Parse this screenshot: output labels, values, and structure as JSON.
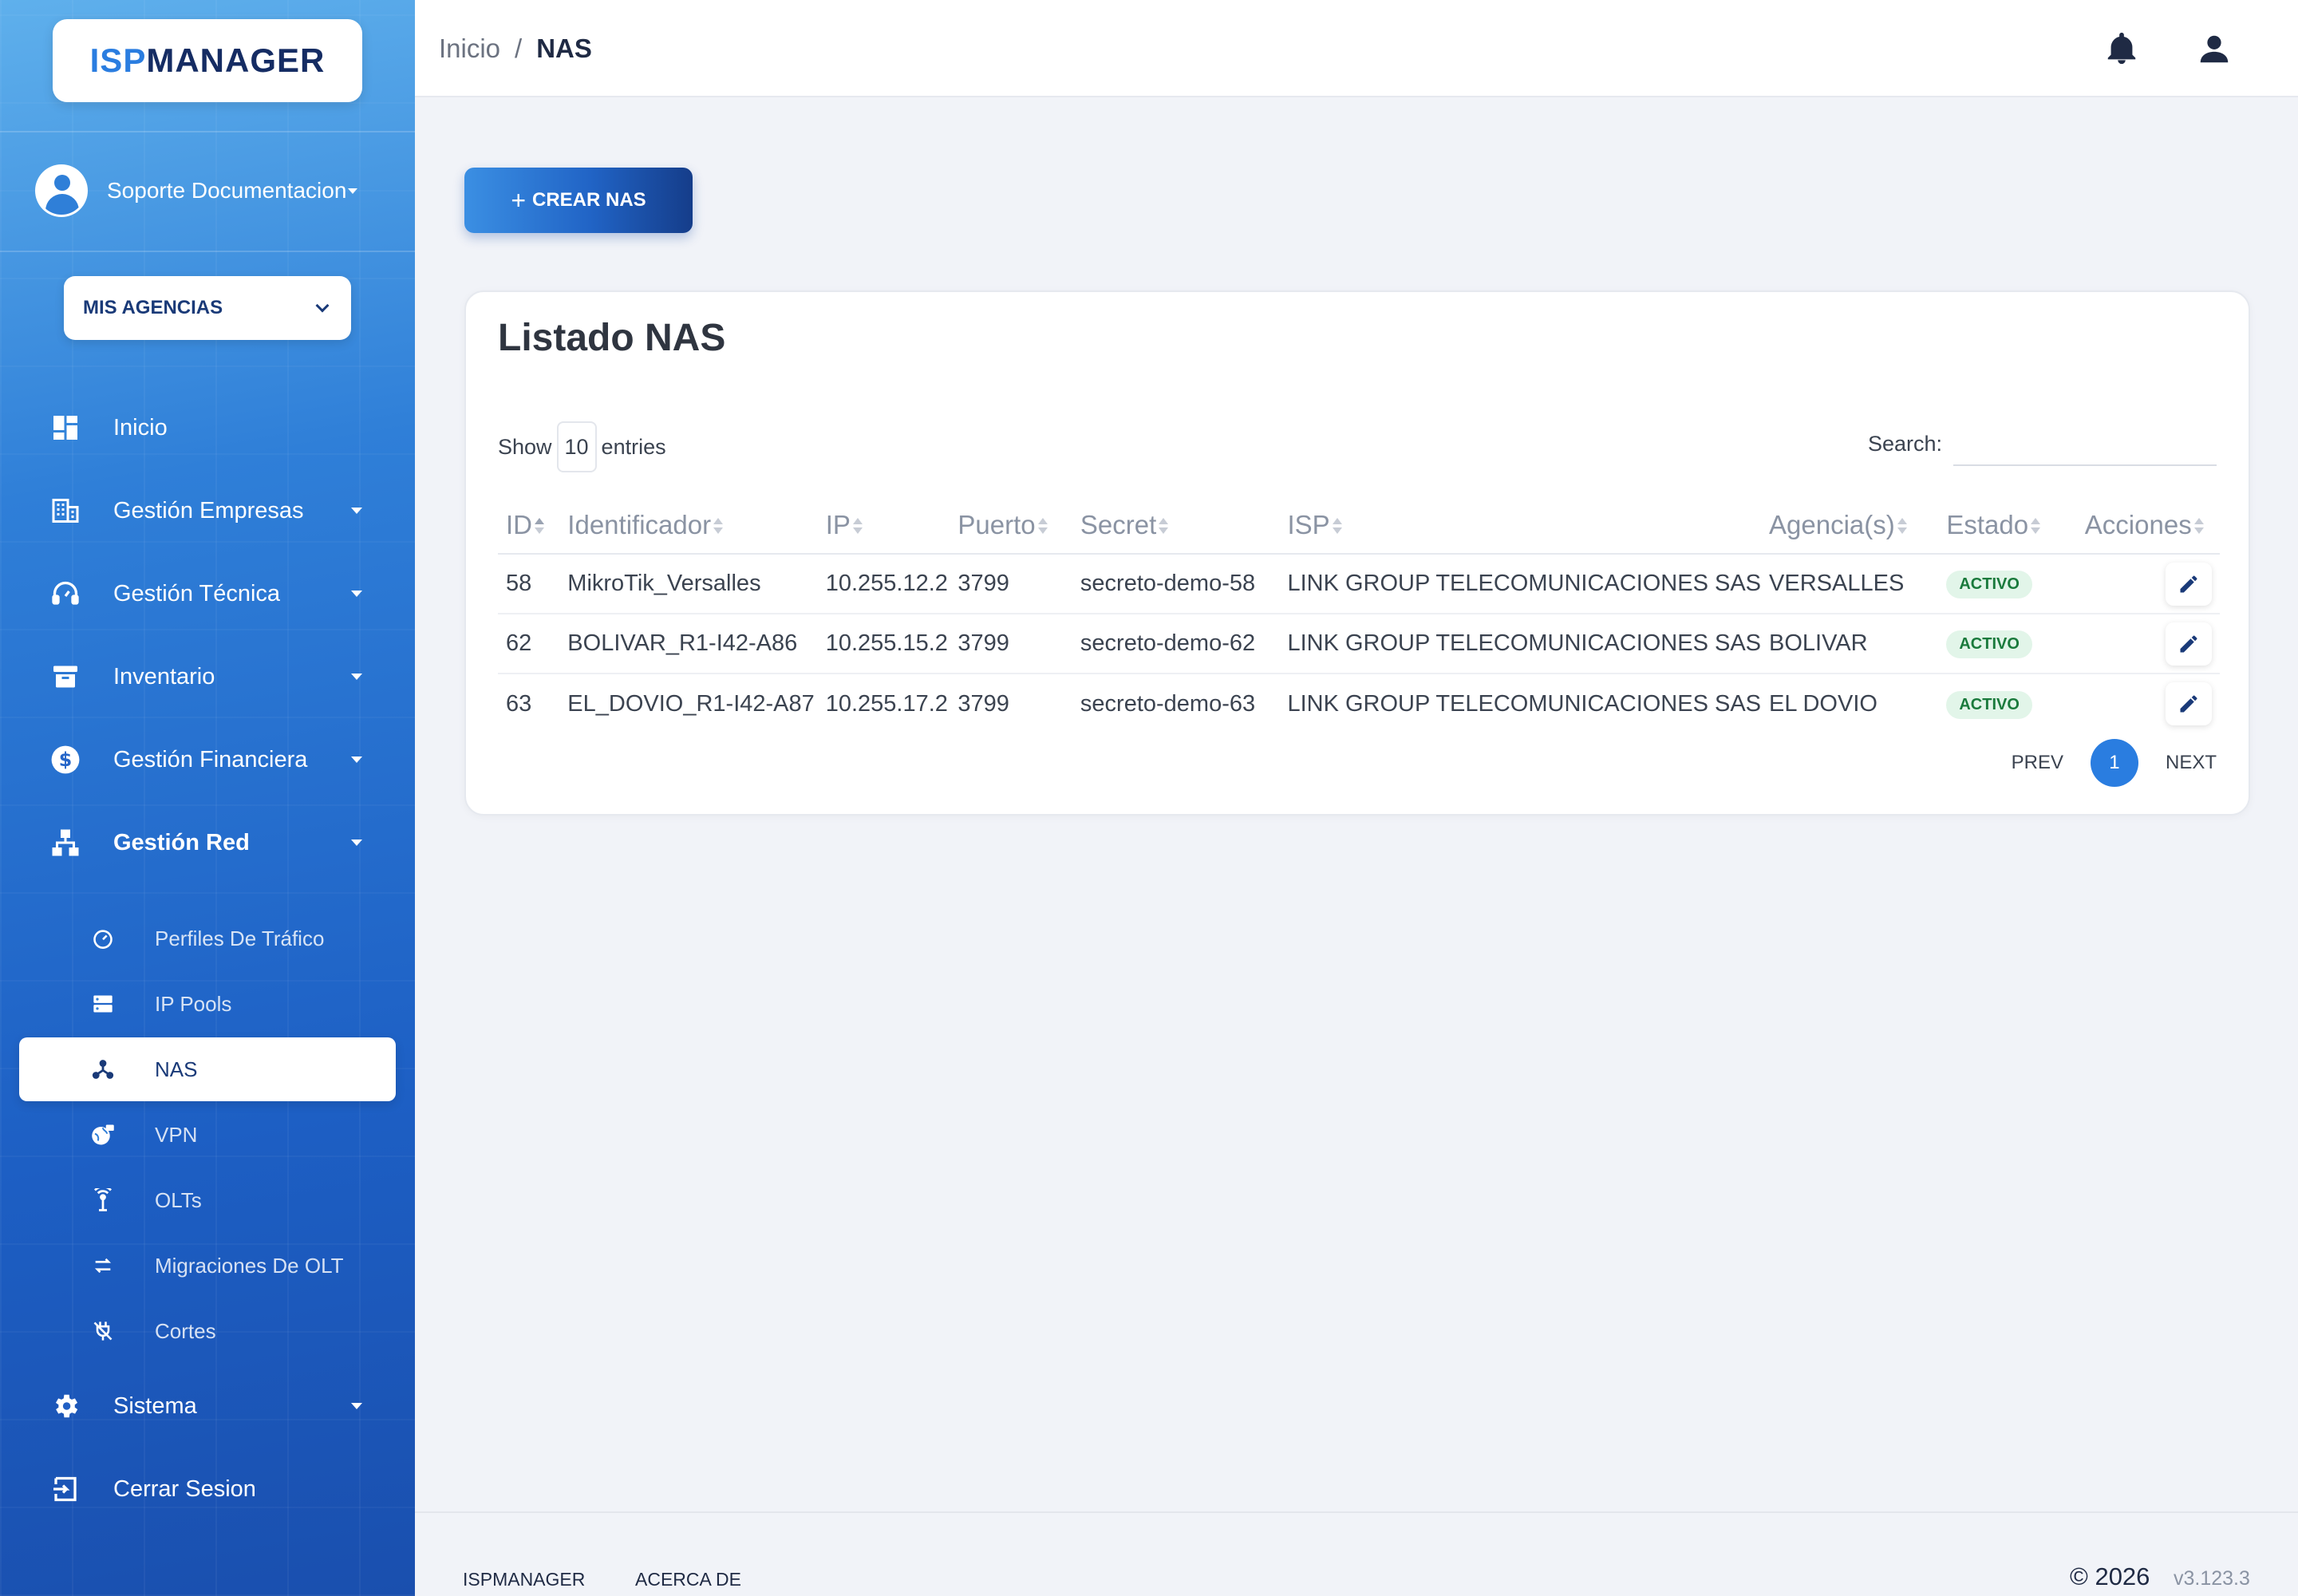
{
  "brand": {
    "part1": "ISP",
    "part2": "MANAGER"
  },
  "user": {
    "name": "Soporte Documentacion"
  },
  "agency_button": {
    "label": "MIS AGENCIAS"
  },
  "nav": [
    {
      "label": "Inicio",
      "icon": "dashboard-icon"
    },
    {
      "label": "Gestión Empresas",
      "icon": "building-icon"
    },
    {
      "label": "Gestión Técnica",
      "icon": "headset-icon"
    },
    {
      "label": "Inventario",
      "icon": "archive-icon"
    },
    {
      "label": "Gestión Financiera",
      "icon": "dollar-icon"
    },
    {
      "label": "Gestión Red",
      "icon": "network-icon"
    }
  ],
  "subnav": [
    {
      "label": "Perfiles De Tráfico",
      "icon": "speedometer-icon"
    },
    {
      "label": "IP Pools",
      "icon": "server-icon"
    },
    {
      "label": "NAS",
      "icon": "hub-icon",
      "active": true
    },
    {
      "label": "VPN",
      "icon": "globe-lock-icon"
    },
    {
      "label": "OLTs",
      "icon": "antenna-icon"
    },
    {
      "label": "Migraciones De OLT",
      "icon": "swap-icon"
    },
    {
      "label": "Cortes",
      "icon": "plug-off-icon"
    }
  ],
  "nav_bottom": [
    {
      "label": "Sistema",
      "icon": "gear-icon"
    },
    {
      "label": "Cerrar Sesion",
      "icon": "logout-icon"
    }
  ],
  "breadcrumb": {
    "home": "Inicio",
    "separator": "/",
    "current": "NAS"
  },
  "create_button": {
    "label": "CREAR NAS"
  },
  "card": {
    "title": "Listado NAS",
    "show_label": "Show",
    "entries_value": "10",
    "entries_label": "entries",
    "search_label": "Search:",
    "search_value": ""
  },
  "table": {
    "columns": [
      "ID",
      "Identificador",
      "IP",
      "Puerto",
      "Secret",
      "ISP",
      "Agencia(s)",
      "Estado",
      "Acciones"
    ],
    "rows": [
      {
        "id": "58",
        "identificador": "MikroTik_Versalles",
        "ip": "10.255.12.2",
        "puerto": "3799",
        "secret": "secreto-demo-58",
        "isp": "LINK GROUP TELECOMUNICACIONES SAS",
        "agencia": "VERSALLES",
        "estado": "ACTIVO"
      },
      {
        "id": "62",
        "identificador": "BOLIVAR_R1-I42-A86",
        "ip": "10.255.15.2",
        "puerto": "3799",
        "secret": "secreto-demo-62",
        "isp": "LINK GROUP TELECOMUNICACIONES SAS",
        "agencia": "BOLIVAR",
        "estado": "ACTIVO"
      },
      {
        "id": "63",
        "identificador": "EL_DOVIO_R1-I42-A87",
        "ip": "10.255.17.2",
        "puerto": "3799",
        "secret": "secreto-demo-63",
        "isp": "LINK GROUP TELECOMUNICACIONES SAS",
        "agencia": "EL DOVIO",
        "estado": "ACTIVO"
      }
    ]
  },
  "pagination": {
    "prev": "PREV",
    "current": "1",
    "next": "NEXT"
  },
  "footer": {
    "link1": "ISPMANAGER",
    "link2": "ACERCA DE",
    "copyright": "© 2026",
    "version": "v3.123.3"
  },
  "colors": {
    "accent": "#2a7de0",
    "brand_dark": "#152c63",
    "badge_bg": "#e2f5e9",
    "badge_text": "#1a7a3c"
  }
}
